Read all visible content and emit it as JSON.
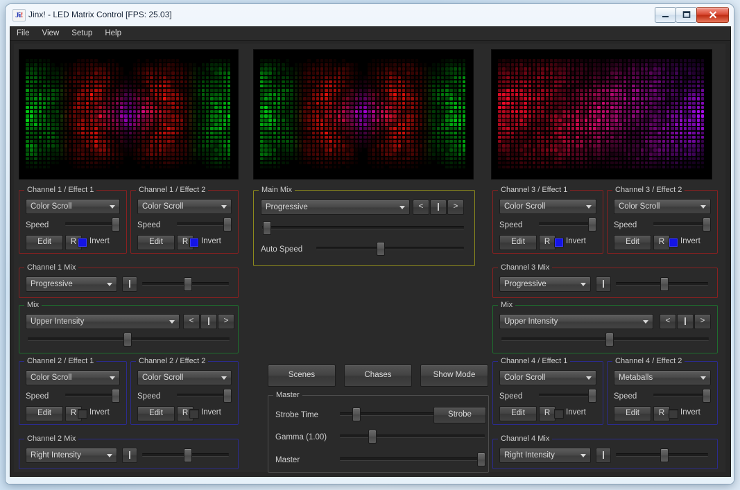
{
  "window": {
    "title": "Jinx! - LED Matrix Control [FPS: 25.03]",
    "icon_main": "Ji",
    "icon_accent": "!",
    "minimize_label": "Minimize",
    "maximize_label": "Maximize",
    "close_label": "Close"
  },
  "menu": {
    "items": [
      "File",
      "View",
      "Setup",
      "Help"
    ]
  },
  "previews": [
    {
      "name": "output-preview-1",
      "columns": 48,
      "rows": 26
    },
    {
      "name": "output-preview-2",
      "columns": 48,
      "rows": 26
    },
    {
      "name": "output-preview-3",
      "columns": 48,
      "rows": 26
    }
  ],
  "labels": {
    "speed": "Speed",
    "edit": "Edit",
    "reset": "R",
    "invert": "Invert",
    "auto_speed": "Auto Speed",
    "strobe_time": "Strobe Time",
    "gamma": "Gamma (1.00)",
    "master": "Master",
    "strobe": "Strobe",
    "prev": "<",
    "bar": "|",
    "next": ">"
  },
  "channels": [
    {
      "effect1": {
        "title": "Channel 1 / Effect 1",
        "effect": "Color Scroll",
        "speed": 95,
        "invert": true
      },
      "effect2": {
        "title": "Channel 1 / Effect 2",
        "effect": "Color Scroll",
        "speed": 95,
        "invert": true
      },
      "mix": {
        "title": "Channel 1 Mix",
        "mode": "Progressive",
        "value": 52
      }
    },
    {
      "effect1": {
        "title": "Channel 2 / Effect 1",
        "effect": "Color Scroll",
        "speed": 95,
        "invert": false
      },
      "effect2": {
        "title": "Channel 2 / Effect 2",
        "effect": "Color Scroll",
        "speed": 95,
        "invert": false
      },
      "mix": {
        "title": "Channel 2 Mix",
        "mode": "Right Intensity",
        "value": 52
      }
    },
    {
      "effect1": {
        "title": "Channel 3 / Effect 1",
        "effect": "Color Scroll",
        "speed": 95,
        "invert": true
      },
      "effect2": {
        "title": "Channel 3 / Effect 2",
        "effect": "Color Scroll",
        "speed": 95,
        "invert": true
      },
      "mix": {
        "title": "Channel 3 Mix",
        "mode": "Progressive",
        "value": 52
      }
    },
    {
      "effect1": {
        "title": "Channel 4 / Effect 1",
        "effect": "Color Scroll",
        "speed": 95,
        "invert": false
      },
      "effect2": {
        "title": "Channel 4 / Effect 2",
        "effect": "Metaballs",
        "speed": 95,
        "invert": false
      },
      "mix": {
        "title": "Channel 4 Mix",
        "mode": "Right Intensity",
        "value": 52
      }
    }
  ],
  "mix_left": {
    "title": "Mix",
    "mode": "Upper Intensity",
    "value": 49
  },
  "mix_right": {
    "title": "Mix",
    "mode": "Upper Intensity",
    "value": 52
  },
  "main_mix": {
    "title": "Main Mix",
    "mode": "Progressive",
    "fader": 2,
    "auto_speed": 43
  },
  "center_buttons": {
    "scenes": "Scenes",
    "chases": "Chases",
    "show_mode": "Show Mode"
  },
  "master_group": {
    "title": "Master",
    "strobe_time": 13,
    "gamma": 22,
    "master": 97
  },
  "colors": {
    "group_red": "#8a2020",
    "group_blue": "#2b2b8e",
    "group_green": "#1e6e2e",
    "group_yellow": "#8d8a1c",
    "group_gray": "#4e4e4e",
    "checkbox_on": "#1414e6",
    "background": "#2a2a2a"
  }
}
